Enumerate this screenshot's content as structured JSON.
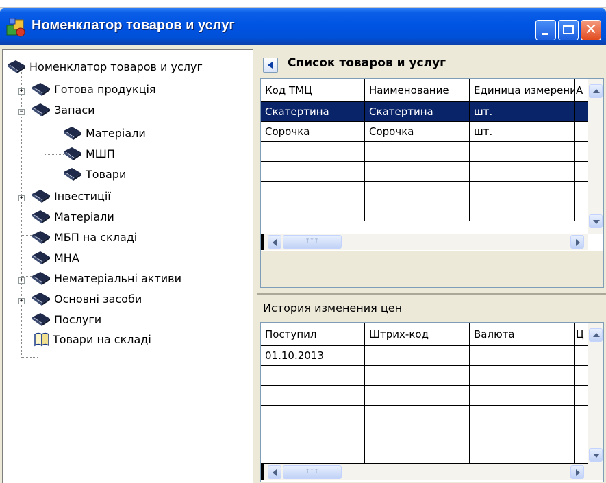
{
  "window": {
    "title": "Номенклатор товаров и услуг",
    "controls": {
      "minimize": "minimize",
      "maximize": "maximize",
      "close": "✕"
    }
  },
  "tree": {
    "root": "Номенклатор товаров и услуг",
    "items": [
      {
        "label": "Готова продукція",
        "expander": "+",
        "level": 1
      },
      {
        "label": "Запаси",
        "expander": "−",
        "level": 1
      },
      {
        "label": "Матеріали",
        "expander": "",
        "level": 2
      },
      {
        "label": "МШП",
        "expander": "",
        "level": 2
      },
      {
        "label": "Товари",
        "expander": "",
        "level": 2
      },
      {
        "label": "Інвестиції",
        "expander": "+",
        "level": 1
      },
      {
        "label": "Матеріали",
        "expander": "",
        "level": 1
      },
      {
        "label": "МБП на складі",
        "expander": "",
        "level": 1
      },
      {
        "label": "МНА",
        "expander": "",
        "level": 1
      },
      {
        "label": "Нематеріальні активи",
        "expander": "+",
        "level": 1
      },
      {
        "label": "Основні засоби",
        "expander": "+",
        "level": 1
      },
      {
        "label": "Послуги",
        "expander": "",
        "level": 1
      },
      {
        "label": "Товари на складі",
        "expander": "",
        "level": 1,
        "icon": "open-book-icon"
      }
    ]
  },
  "goods": {
    "title": "Список товаров и услуг",
    "columns": [
      "Код ТМЦ",
      "Наименование",
      "Единица измерения",
      "А"
    ],
    "rows": [
      [
        "Скатертина",
        "Скатертина",
        "шт."
      ],
      [
        "Сорочка",
        "Сорочка",
        "шт."
      ]
    ]
  },
  "history": {
    "title": "История изменения цен",
    "columns": [
      "Поступил",
      "Штрих-код",
      "Валюта",
      "Ц"
    ],
    "rows": [
      [
        "01.10.2013",
        "",
        ""
      ]
    ]
  },
  "scroll": {
    "thumb_grip": "III"
  },
  "colors": {
    "titlebar": "#0054e3",
    "selection": "#0a246a",
    "window_bg": "#ece9d8"
  }
}
